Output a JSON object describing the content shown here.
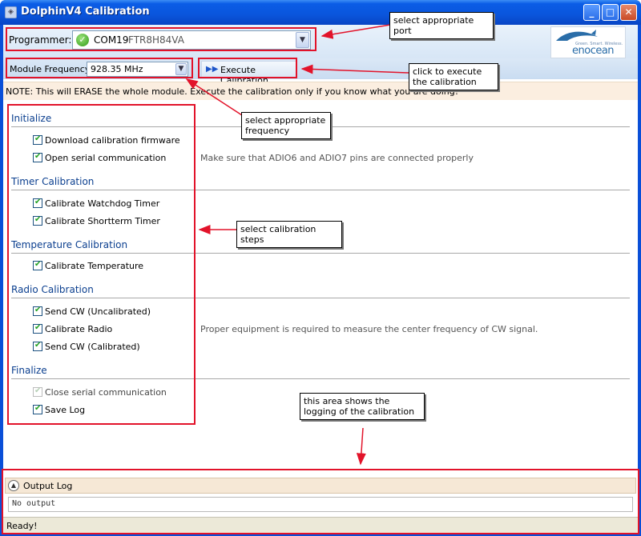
{
  "window": {
    "title": "DolphinV4 Calibration",
    "minimize_label": "_",
    "maximize_label": "□",
    "close_label": "✕"
  },
  "programmer": {
    "label": "Programmer:",
    "port": "COM19",
    "serial": "FTR8H84VA",
    "status_icon": "check-ok-icon"
  },
  "logo": {
    "tagline": "Green. Smart. Wireless.",
    "wordmark": "enocean"
  },
  "frequency": {
    "label": "Module Frequency:",
    "value": "928.35 MHz"
  },
  "execute": {
    "label": "Execute Calibration",
    "icon": "fast-forward-icon"
  },
  "note": "NOTE: This will ERASE the whole module. Execute the calibration only if you know what you are doing!",
  "sections": [
    {
      "title": "Initialize",
      "steps": [
        {
          "label": "Download calibration firmware",
          "checked": true,
          "enabled": true
        },
        {
          "label": "Open serial communication",
          "checked": true,
          "enabled": true,
          "hint": "Make sure that ADIO6 and ADIO7 pins are connected properly"
        }
      ]
    },
    {
      "title": "Timer Calibration",
      "steps": [
        {
          "label": "Calibrate Watchdog Timer",
          "checked": true,
          "enabled": true
        },
        {
          "label": "Calibrate Shortterm Timer",
          "checked": true,
          "enabled": true
        }
      ]
    },
    {
      "title": "Temperature Calibration",
      "steps": [
        {
          "label": "Calibrate Temperature",
          "checked": true,
          "enabled": true
        }
      ]
    },
    {
      "title": "Radio Calibration",
      "steps": [
        {
          "label": "Send CW (Uncalibrated)",
          "checked": true,
          "enabled": true
        },
        {
          "label": "Calibrate Radio",
          "checked": true,
          "enabled": true,
          "hint": "Proper equipment is required to measure the center frequency of CW signal."
        },
        {
          "label": "Send CW (Calibrated)",
          "checked": true,
          "enabled": true
        }
      ]
    },
    {
      "title": "Finalize",
      "steps": [
        {
          "label": "Close serial communication",
          "checked": true,
          "enabled": false
        },
        {
          "label": "Save Log",
          "checked": true,
          "enabled": true
        }
      ]
    }
  ],
  "output_log": {
    "title": "Output Log",
    "text": "No output"
  },
  "status": "Ready!",
  "annotations": {
    "port": "select appropriate port",
    "execute": "click to execute the calibration",
    "frequency": "select appropriate frequency",
    "steps": "select calibration steps",
    "logging": "this area shows the logging of the calibration"
  },
  "colors": {
    "titlebar": "#0a55dc",
    "annotation_red": "#e2132a",
    "section_title": "#0b3f8f",
    "check_green": "#21a121"
  }
}
